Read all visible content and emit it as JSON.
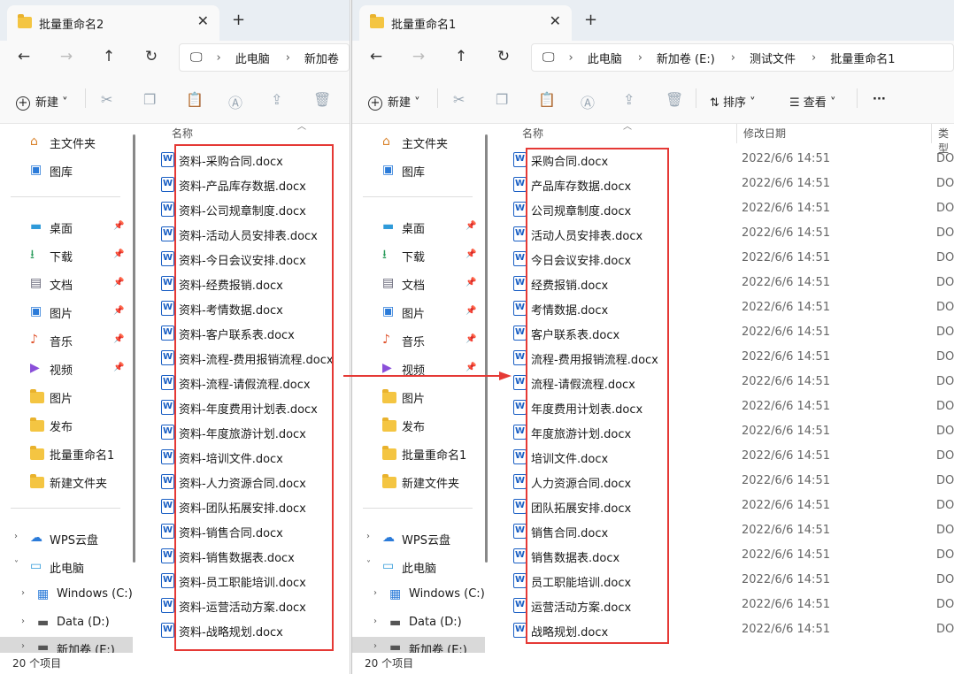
{
  "left": {
    "tab_title": "批量重命名2",
    "breadcrumb": [
      "此电脑",
      "新加卷"
    ],
    "new_label": "新建",
    "col_name": "名称",
    "files": [
      "资料-采购合同.docx",
      "资料-产品库存数据.docx",
      "资料-公司规章制度.docx",
      "资料-活动人员安排表.docx",
      "资料-今日会议安排.docx",
      "资料-经费报销.docx",
      "资料-考情数据.docx",
      "资料-客户联系表.docx",
      "资料-流程-费用报销流程.docx",
      "资料-流程-请假流程.docx",
      "资料-年度费用计划表.docx",
      "资料-年度旅游计划.docx",
      "资料-培训文件.docx",
      "资料-人力资源合同.docx",
      "资料-团队拓展安排.docx",
      "资料-销售合同.docx",
      "资料-销售数据表.docx",
      "资料-员工职能培训.docx",
      "资料-运营活动方案.docx",
      "资料-战略规划.docx"
    ],
    "status": "20 个项目"
  },
  "right": {
    "tab_title": "批量重命名1",
    "breadcrumb": [
      "此电脑",
      "新加卷 (E:)",
      "测试文件",
      "批量重命名1"
    ],
    "new_label": "新建",
    "sort_label": "排序",
    "view_label": "查看",
    "more_label": "···",
    "col_name": "名称",
    "col_date": "修改日期",
    "col_type": "类型",
    "date_value": "2022/6/6 14:51",
    "type_value": "DO",
    "files": [
      "采购合同.docx",
      "产品库存数据.docx",
      "公司规章制度.docx",
      "活动人员安排表.docx",
      "今日会议安排.docx",
      "经费报销.docx",
      "考情数据.docx",
      "客户联系表.docx",
      "流程-费用报销流程.docx",
      "流程-请假流程.docx",
      "年度费用计划表.docx",
      "年度旅游计划.docx",
      "培训文件.docx",
      "人力资源合同.docx",
      "团队拓展安排.docx",
      "销售合同.docx",
      "销售数据表.docx",
      "员工职能培训.docx",
      "运营活动方案.docx",
      "战略规划.docx"
    ],
    "status": "20 个项目"
  },
  "nav": {
    "home": "主文件夹",
    "gallery": "图库",
    "desktop": "桌面",
    "downloads": "下载",
    "documents": "文档",
    "pictures": "图片",
    "music": "音乐",
    "videos": "视频",
    "folder_pictures": "图片",
    "folder_publish": "发布",
    "folder_batch": "批量重命名1",
    "folder_new": "新建文件夹",
    "wps": "WPS云盘",
    "thispc": "此电脑",
    "drive_c": "Windows (C:)",
    "drive_d": "Data (D:)",
    "drive_e": "新加卷 (E:)"
  },
  "icons": {
    "doc": "word-doc-icon",
    "close": "close-icon",
    "add_tab": "plus-icon"
  },
  "colors": {
    "highlight": "#e53935",
    "accent": "#1a5fc4"
  }
}
